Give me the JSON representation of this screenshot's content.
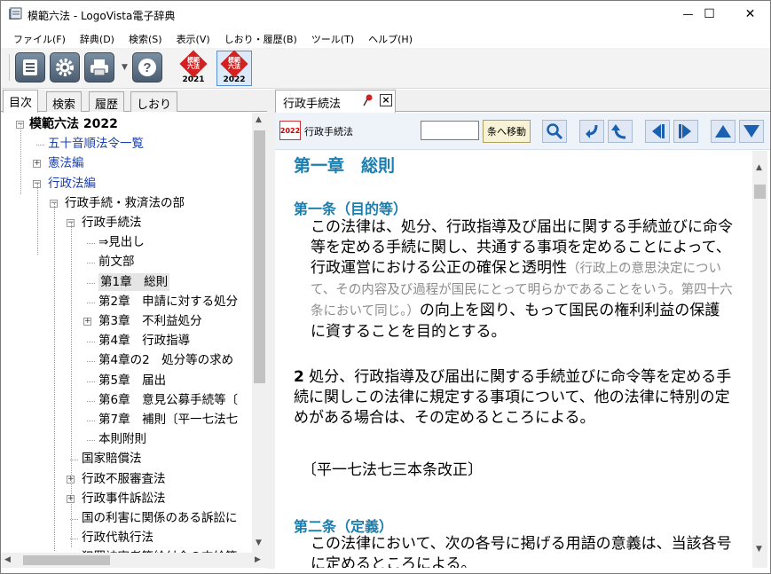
{
  "window": {
    "title": "模範六法 - LogoVista電子辞典",
    "minimize": "—",
    "maximize": "☐",
    "close": "✕"
  },
  "menu": [
    "ファイル(F)",
    "辞典(D)",
    "検索(S)",
    "表示(V)",
    "しおり・履歴(B)",
    "ツール(T)",
    "ヘルプ(H)"
  ],
  "toolbar": {
    "dict1_label": "模範\n六法",
    "dict1_year": "2021",
    "dict2_label": "模範\n六法",
    "dict2_year": "2022"
  },
  "left_tabs": [
    "目次",
    "検索",
    "履歴",
    "しおり"
  ],
  "tree": [
    {
      "label": "模範六法 2022",
      "level": 0,
      "expander": "−",
      "root": true,
      "blue": false
    },
    {
      "label": "五十音順法令一覧",
      "level": 1,
      "expander": "",
      "blue": true
    },
    {
      "label": "憲法編",
      "level": 1,
      "expander": "+",
      "blue": true
    },
    {
      "label": "行政法編",
      "level": 1,
      "expander": "−",
      "blue": true
    },
    {
      "label": "行政手続・救済法の部",
      "level": 2,
      "expander": "−",
      "blue": false
    },
    {
      "label": "行政手続法",
      "level": 3,
      "expander": "−",
      "blue": false
    },
    {
      "label": "⇒見出し",
      "level": 4,
      "expander": "",
      "blue": false
    },
    {
      "label": "前文部",
      "level": 4,
      "expander": "",
      "blue": false
    },
    {
      "label": "第1章　総則",
      "level": 4,
      "expander": "",
      "blue": false,
      "selected": true
    },
    {
      "label": "第2章　申請に対する処分",
      "level": 4,
      "expander": "",
      "blue": false
    },
    {
      "label": "第3章　不利益処分",
      "level": 4,
      "expander": "+",
      "blue": false
    },
    {
      "label": "第4章　行政指導",
      "level": 4,
      "expander": "",
      "blue": false
    },
    {
      "label": "第4章の2　処分等の求め",
      "level": 4,
      "expander": "",
      "blue": false
    },
    {
      "label": "第5章　届出",
      "level": 4,
      "expander": "",
      "blue": false
    },
    {
      "label": "第6章　意見公募手続等〔",
      "level": 4,
      "expander": "",
      "blue": false
    },
    {
      "label": "第7章　補則〔平一七法七",
      "level": 4,
      "expander": "",
      "blue": false
    },
    {
      "label": "本則附則",
      "level": 4,
      "expander": "",
      "blue": false
    },
    {
      "label": "国家賠償法",
      "level": 3,
      "expander": "",
      "blue": false
    },
    {
      "label": "行政不服審査法",
      "level": 3,
      "expander": "+",
      "blue": false
    },
    {
      "label": "行政事件訴訟法",
      "level": 3,
      "expander": "+",
      "blue": false
    },
    {
      "label": "国の利害に関係のある訴訟に",
      "level": 3,
      "expander": "",
      "blue": false
    },
    {
      "label": "行政代執行法",
      "level": 3,
      "expander": "",
      "blue": false
    },
    {
      "label": "犯罪被害者等給付金の支給等",
      "level": 3,
      "expander": "",
      "blue": false
    }
  ],
  "doc": {
    "tab_label": "行政手続法",
    "badge": "2022",
    "label": "行政手続法",
    "jump_button": "条へ移動",
    "chapter": "第一章　総則",
    "art1_head": "第一条（目的等）",
    "art1_p1_a": "この法律は、処分、行政指導及び届出に関する手続並びに命令等を定める手続に関し、共通する事項を定めることによって、行政運営における公正の確保と透明性",
    "art1_p1_note": "（行政上の意思決定について、その内容及び過程が国民にとって明らかであることをいう。第四十六条において同じ。）",
    "art1_p1_b": "の向上を図り、もって国民の権利利益の保護に資することを目的とする。",
    "art1_p2_num": "2",
    "art1_p2": "処分、行政指導及び届出に関する手続並びに命令等を定める手続に関しこの法律に規定する事項について、他の法律に特別の定めがある場合は、その定めるところによる。",
    "amend": "〔平一七法七三本条改正〕",
    "art2_head": "第二条（定義）",
    "art2_p1": "この法律において、次の各号に掲げる用語の意義は、当該各号に定めるところによる。"
  },
  "colors": {
    "heading": "#1a7fb0",
    "tree_blue": "#1a3fb0",
    "note_gray": "#8c8c8c",
    "dict_red": "#d42020"
  }
}
